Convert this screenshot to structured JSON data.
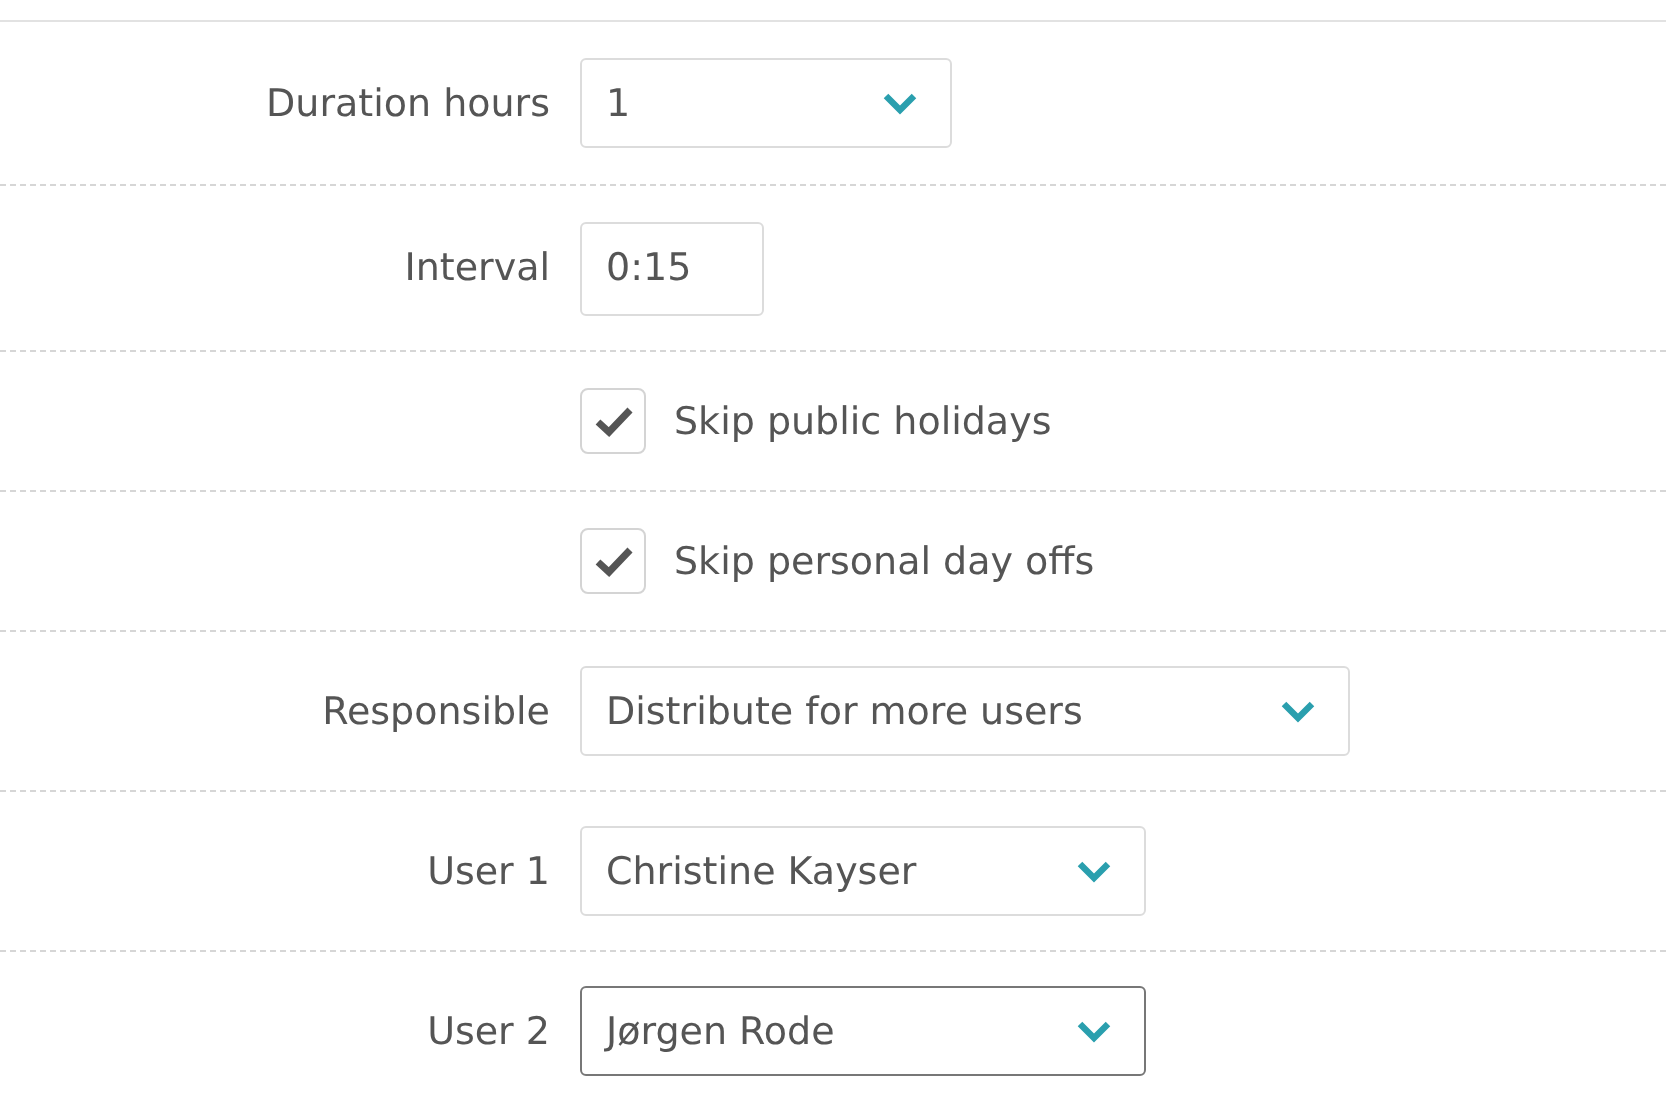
{
  "rows": [
    {
      "kind": "select",
      "label": "Duration hours",
      "value": "1",
      "focused": false
    },
    {
      "kind": "input",
      "label": "Interval",
      "value": "0:15"
    },
    {
      "kind": "checkbox",
      "text": "Skip public holidays",
      "checked": true
    },
    {
      "kind": "checkbox",
      "text": "Skip personal day offs",
      "checked": true
    },
    {
      "kind": "select",
      "label": "Responsible",
      "value": "Distribute for more users",
      "focused": false
    },
    {
      "kind": "select",
      "label": "User 1",
      "value": "Christine Kayser",
      "focused": false
    },
    {
      "kind": "select",
      "label": "User 2",
      "value": "Jørgen Rode",
      "focused": true
    }
  ]
}
